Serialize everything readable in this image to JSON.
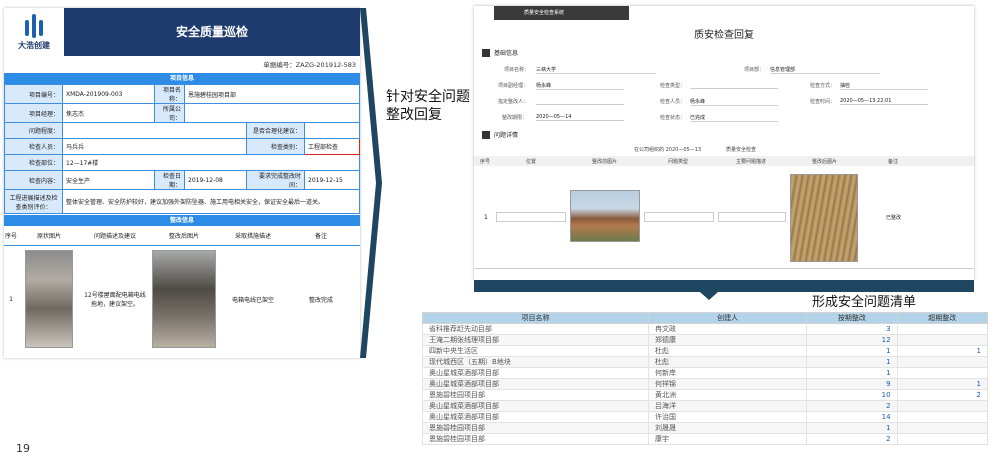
{
  "left": {
    "logo_text": "大浩创建",
    "title": "安全质量巡检",
    "doc_no": "单据编号：ZAZG-201912-583",
    "section_project": "项目信息",
    "rows": [
      [
        {
          "l": "项目编号：",
          "v": "XMDA-201909-003"
        },
        {
          "l": "项目名称：",
          "v": "恩施碧桂园项目部"
        }
      ],
      [
        {
          "l": "项目经理：",
          "v": "焦志杰"
        },
        {
          "l": "所属公司：",
          "v": ""
        }
      ],
      [
        {
          "l": "问题程度：",
          "v": ""
        },
        {
          "l": "是否合理化建议：",
          "v": ""
        }
      ],
      [
        {
          "l": "检查人员：",
          "v": "马兵兵"
        },
        {
          "l": "检查类别：",
          "v": "工程部检查"
        }
      ],
      [
        {
          "l": "检查部位：",
          "v": "12—17#楼"
        }
      ],
      [
        {
          "l": "检查内容：",
          "v": "安全生产"
        },
        {
          "l": "检查日期：",
          "v": "2019-12-08"
        },
        {
          "l": "要求完成整改时间：",
          "v": "2019-12-15"
        }
      ],
      [
        {
          "l": "工程进展描述及检查类别评价：",
          "v": "整体安全管理、安全防护较好，建议加强外架防坠器、施工用电相关安全，保证安全最后一道关。"
        }
      ]
    ],
    "section_fix": "整改信息",
    "fix_headers": [
      "序号",
      "原状图片",
      "问题描述及建议",
      "整改后图片",
      "采取措施描述",
      "备注"
    ],
    "fix_row": {
      "no": "1",
      "desc": "12号楼屋面配电箱电线拖地，建议架空。",
      "measure": "电箱电线已架空",
      "remark": "整改完成"
    }
  },
  "label_top": "针对安全问题整改回复",
  "label_bottom": "形成安全问题清单",
  "right_top": {
    "sys": "质量安全检查系统",
    "title": "质安检查回复",
    "sec_basic": "基础信息",
    "sec_detail": "问题详情",
    "fields": [
      {
        "l": "项目名称：",
        "v": "三峡大学"
      },
      {
        "l": "项目部：",
        "v": "信息管理部"
      },
      {
        "l": "项目副经理：",
        "v": "杨永峰"
      },
      {
        "l": "检查类型：",
        "v": ""
      },
      {
        "l": "检查方式：",
        "v": "抽检"
      },
      {
        "l": "指定整改人：",
        "v": ""
      },
      {
        "l": "检查人员：",
        "v": "杨永峰"
      },
      {
        "l": "检查时间：",
        "v": "2020—05—13 22:01"
      },
      {
        "l": "整改期限：",
        "v": "2020—05—14"
      },
      {
        "l": "检查状态：",
        "v": "已完成"
      }
    ],
    "sub_l": "在公司组织的 2020—05—13",
    "sub_r": "质量安全检查",
    "col_headers": [
      "序号",
      "位置",
      "整改前图片",
      "问题类型",
      "主要问题描述",
      "整改后图片",
      "备注"
    ],
    "row_no": "1",
    "row_remark": "已整改"
  },
  "right_bottom": {
    "headers": [
      "项目名称",
      "创建人",
      "按期整改",
      "超期整改"
    ],
    "rows": [
      [
        "省科推荐赶先动目部",
        "冉文政",
        "3",
        ""
      ],
      [
        "王淹二期张线理项目部",
        "郑德康",
        "12",
        ""
      ],
      [
        "四新中央生活区",
        "杜彪",
        "1",
        "1"
      ],
      [
        "现代城西区（五期）B地块",
        "杜彪",
        "1",
        ""
      ],
      [
        "奥山星城菜酒部项目部",
        "何新岸",
        "1",
        ""
      ],
      [
        "奥山星城菜酒部项目部",
        "何祥锦",
        "9",
        "1"
      ],
      [
        "恩施碧桂园项目部",
        "黄北洲",
        "10",
        "2"
      ],
      [
        "奥山星城菜酒部项目部",
        "吕海洋",
        "2",
        ""
      ],
      [
        "奥山星城菜酒部项目部",
        "许治国",
        "14",
        ""
      ],
      [
        "恩施碧桂园项目部",
        "刘晟晟",
        "1",
        ""
      ],
      [
        "恩施碧桂园项目部",
        "康宇",
        "2",
        ""
      ]
    ]
  },
  "page_number": "19",
  "colors": {
    "header": "#1f3c6e",
    "accent": "#2d8ce6",
    "band": "#1e4660",
    "table_head": "#b3d3ea"
  }
}
